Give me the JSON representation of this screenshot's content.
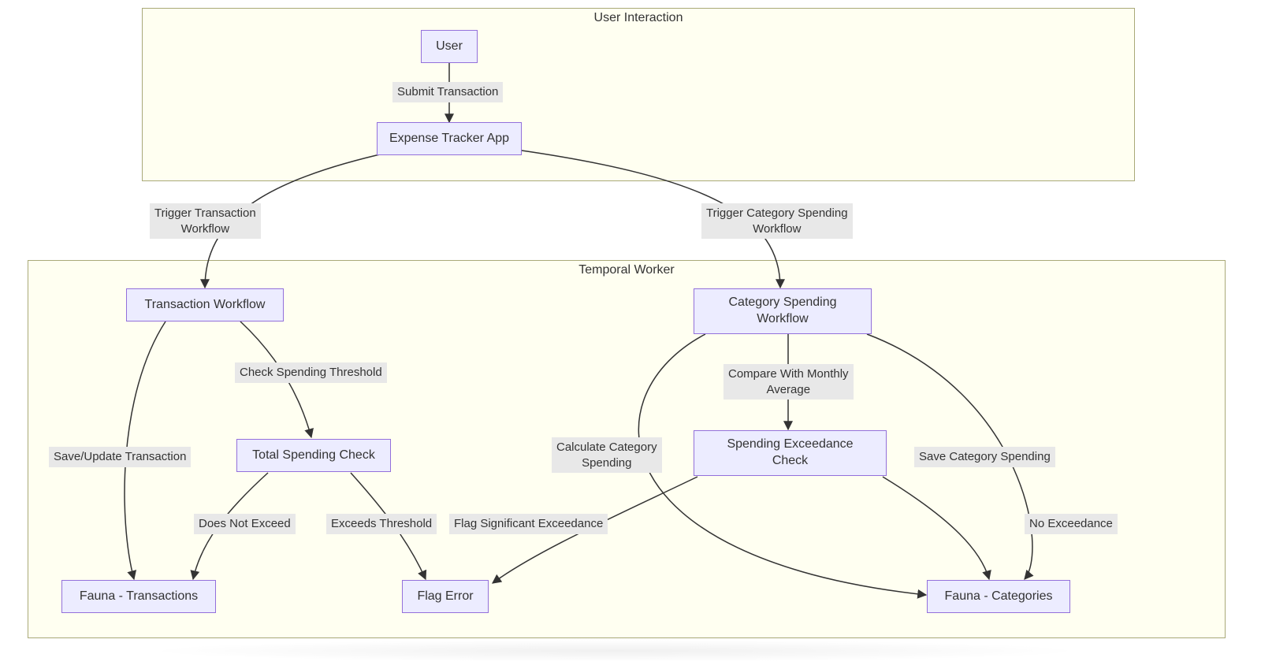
{
  "subgraphs": {
    "user_interaction": {
      "title": "User Interaction"
    },
    "temporal_worker": {
      "title": "Temporal Worker"
    }
  },
  "nodes": {
    "user": "User",
    "expense_tracker_app": "Expense Tracker App",
    "transaction_workflow": "Transaction Workflow",
    "category_spending_workflow": "Category Spending\nWorkflow",
    "total_spending_check": "Total Spending Check",
    "spending_exceedance_check": "Spending Exceedance\nCheck",
    "fauna_transactions": "Fauna - Transactions",
    "flag_error": "Flag Error",
    "fauna_categories": "Fauna - Categories"
  },
  "edges": {
    "submit_transaction": "Submit Transaction",
    "trigger_transaction_workflow": "Trigger Transaction\nWorkflow",
    "trigger_category_spending_workflow": "Trigger Category Spending\nWorkflow",
    "check_spending_threshold": "Check Spending Threshold",
    "compare_monthly_average": "Compare With Monthly\nAverage",
    "save_update_transaction": "Save/Update Transaction",
    "calculate_category_spending": "Calculate Category\nSpending",
    "save_category_spending": "Save Category Spending",
    "does_not_exceed": "Does Not Exceed",
    "exceeds_threshold": "Exceeds Threshold",
    "flag_significant_exceedance": "Flag Significant Exceedance",
    "no_exceedance": "No Exceedance"
  }
}
